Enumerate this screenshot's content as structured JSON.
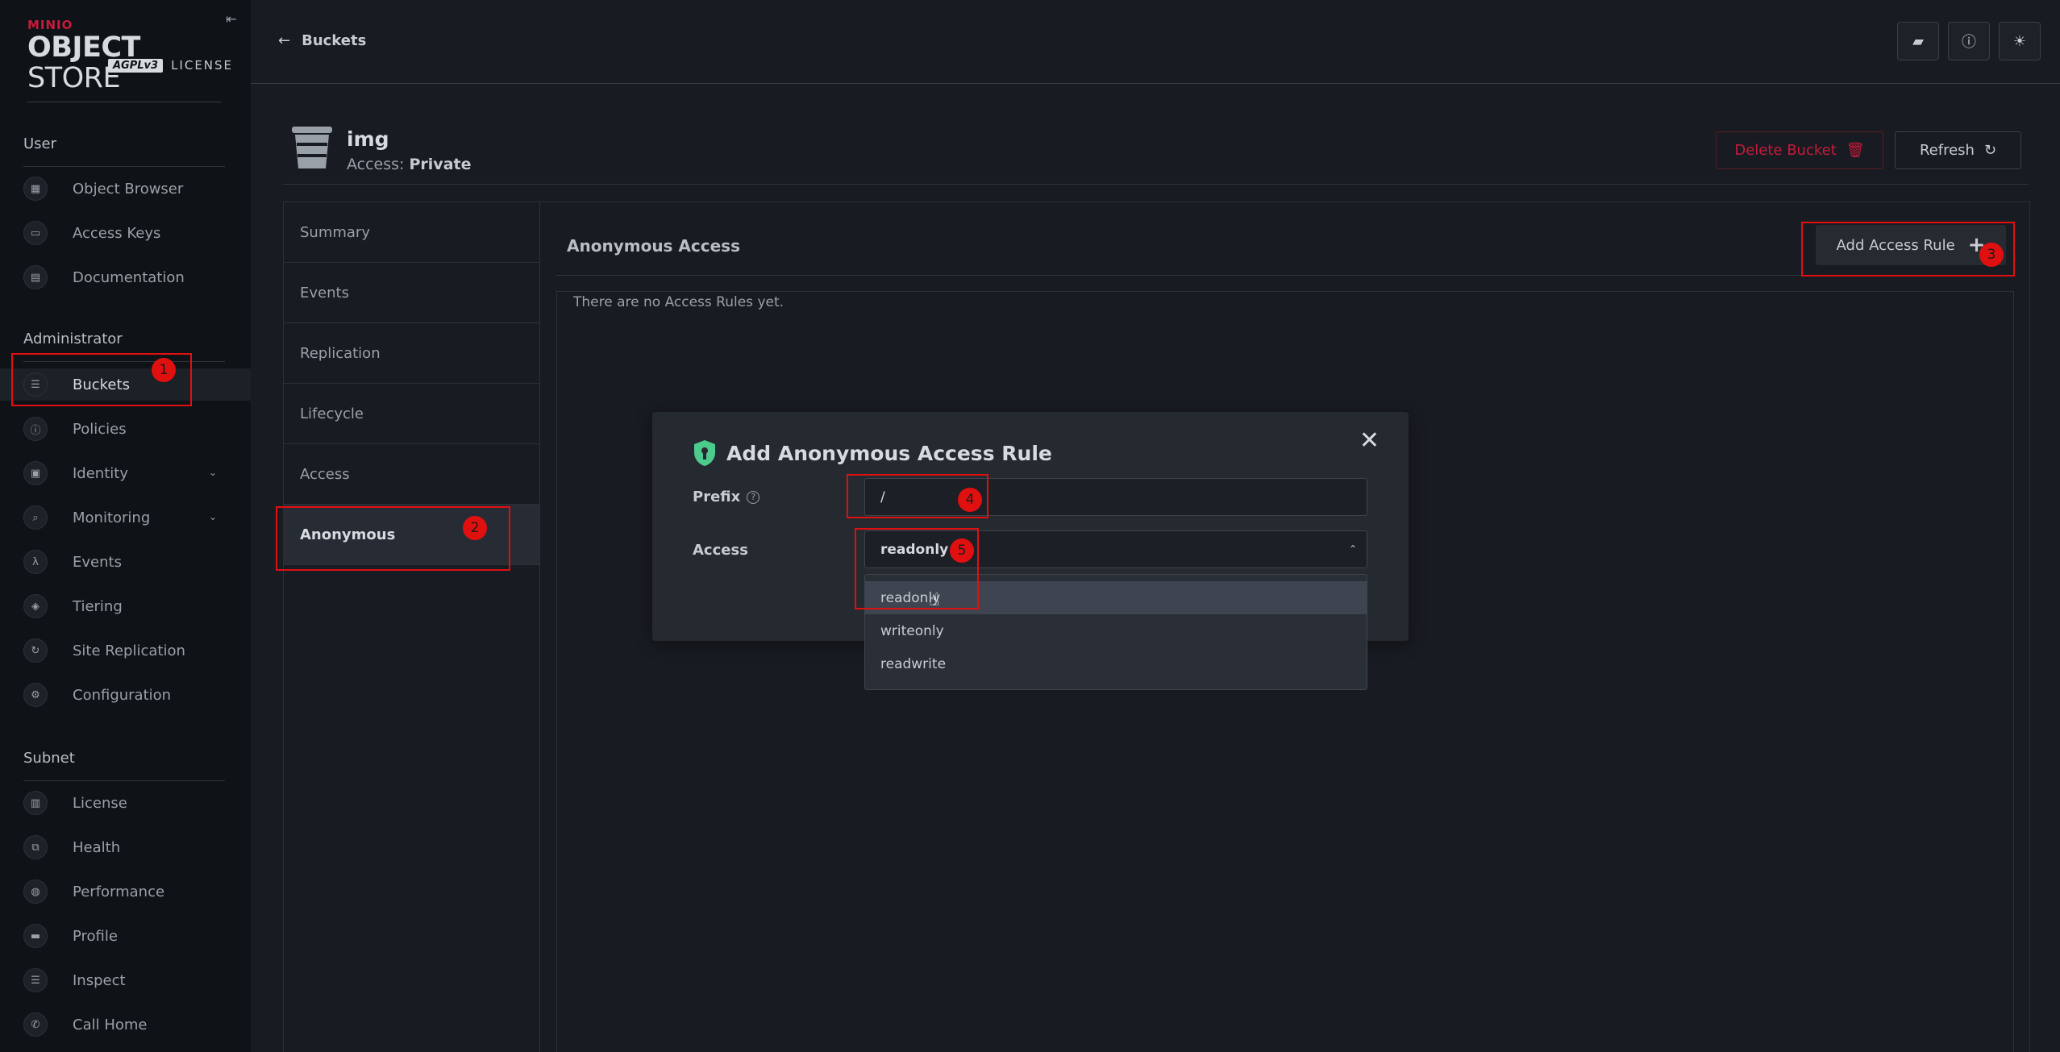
{
  "logo": {
    "brand": "MINIO",
    "product_bold": "OBJECT",
    "product_light": " STORE",
    "badge": "AGPLv3",
    "license": "LICENSE"
  },
  "sidebar": {
    "sections": [
      {
        "title": "User",
        "items": [
          {
            "label": "Object Browser",
            "icon": "object-browser-icon"
          },
          {
            "label": "Access Keys",
            "icon": "access-keys-icon"
          },
          {
            "label": "Documentation",
            "icon": "documentation-icon"
          }
        ]
      },
      {
        "title": "Administrator",
        "items": [
          {
            "label": "Buckets",
            "icon": "bucket-icon",
            "active": true
          },
          {
            "label": "Policies",
            "icon": "policies-icon"
          },
          {
            "label": "Identity",
            "icon": "identity-icon",
            "expandable": true
          },
          {
            "label": "Monitoring",
            "icon": "monitoring-icon",
            "expandable": true
          },
          {
            "label": "Events",
            "icon": "lambda-icon"
          },
          {
            "label": "Tiering",
            "icon": "tiering-icon"
          },
          {
            "label": "Site Replication",
            "icon": "site-replication-icon"
          },
          {
            "label": "Configuration",
            "icon": "gear-icon"
          }
        ]
      },
      {
        "title": "Subnet",
        "items": [
          {
            "label": "License",
            "icon": "license-icon"
          },
          {
            "label": "Health",
            "icon": "health-icon"
          },
          {
            "label": "Performance",
            "icon": "performance-icon"
          },
          {
            "label": "Profile",
            "icon": "profile-icon"
          },
          {
            "label": "Inspect",
            "icon": "inspect-icon"
          },
          {
            "label": "Call Home",
            "icon": "call-home-icon"
          }
        ]
      }
    ]
  },
  "topbar": {
    "back_label": "Buckets"
  },
  "bucket": {
    "name": "img",
    "access_label": "Access:",
    "access_value": "Private"
  },
  "actions": {
    "delete_label": "Delete Bucket",
    "refresh_label": "Refresh"
  },
  "tabs": [
    "Summary",
    "Events",
    "Replication",
    "Lifecycle",
    "Access",
    "Anonymous"
  ],
  "active_tab": "Anonymous",
  "content": {
    "title": "Anonymous Access",
    "add_button": "Add Access Rule",
    "empty_text": "There are no Access Rules yet."
  },
  "modal": {
    "title": "Add Anonymous Access Rule",
    "prefix_label": "Prefix",
    "prefix_value": "/",
    "access_label": "Access",
    "access_value": "readonly",
    "options": [
      "readonly",
      "writeonly",
      "readwrite"
    ],
    "highlighted_option": "readonly"
  },
  "annotations": [
    "1",
    "2",
    "3",
    "4",
    "5"
  ],
  "colors": {
    "accent_red": "#c51b3c",
    "annotation_red": "#e01010",
    "shield_green": "#4ccb8d"
  }
}
